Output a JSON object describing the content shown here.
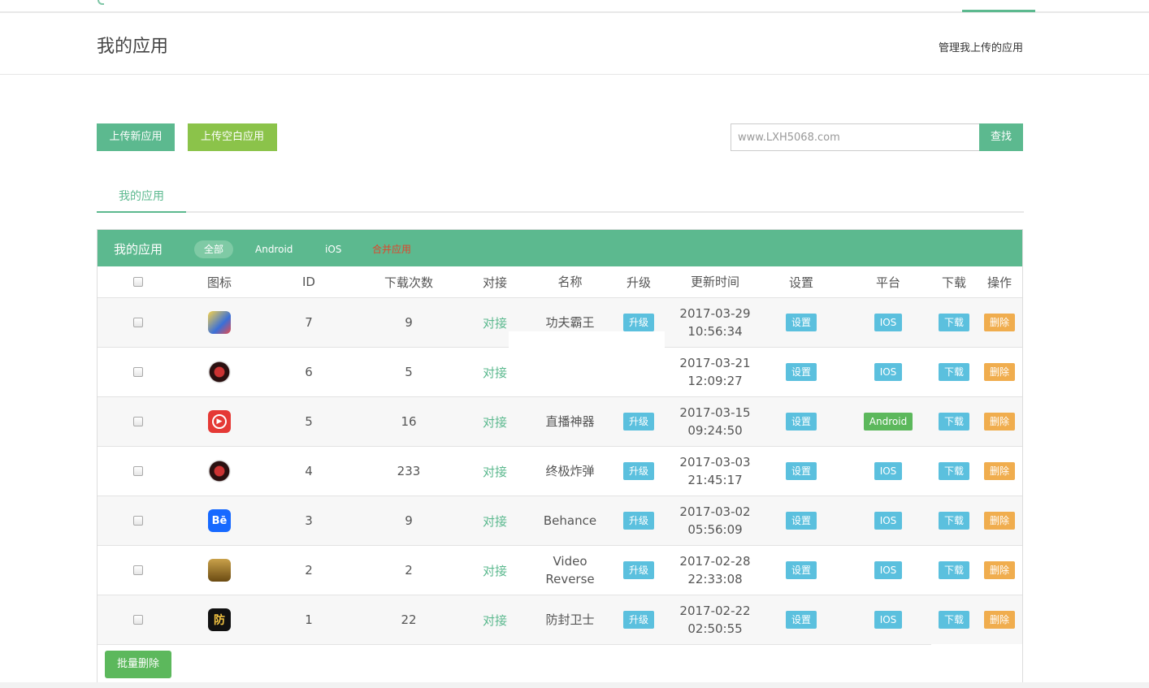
{
  "header": {
    "title": "我的应用",
    "manage_link": "管理我上传的应用"
  },
  "actions": {
    "upload_new": "上传新应用",
    "upload_blank": "上传空白应用",
    "search_value": "www.LXH5068.com",
    "search_button": "查找"
  },
  "tabs": [
    "我的应用"
  ],
  "panel": {
    "title": "我的应用",
    "filters": [
      "全部",
      "Android",
      "iOS",
      "合并应用"
    ],
    "columns": [
      "图标",
      "ID",
      "下载次数",
      "对接",
      "名称",
      "升级",
      "更新时间",
      "设置",
      "平台",
      "下载",
      "操作"
    ],
    "rows": [
      {
        "icon": "game-app-icon",
        "id": "7",
        "downloads": "9",
        "link": "对接",
        "name": "功夫霸王",
        "upgrade": "升级",
        "date": "2017-03-29",
        "time": "10:56:34",
        "settings": "设置",
        "platform": "IOS",
        "download": "下载",
        "delete": "删除"
      },
      {
        "icon": "bomb-app-icon",
        "id": "6",
        "downloads": "5",
        "link": "对接",
        "name": "",
        "upgrade": "",
        "date": "2017-03-21",
        "time": "12:09:27",
        "settings": "设置",
        "platform": "IOS",
        "download": "下载",
        "delete": "删除"
      },
      {
        "icon": "live-app-icon",
        "id": "5",
        "downloads": "16",
        "link": "对接",
        "name": "直播神器",
        "upgrade": "升级",
        "date": "2017-03-15",
        "time": "09:24:50",
        "settings": "设置",
        "platform": "Android",
        "download": "下载",
        "delete": "删除"
      },
      {
        "icon": "bomb-app-icon",
        "id": "4",
        "downloads": "233",
        "link": "对接",
        "name": "终极炸弹",
        "upgrade": "升级",
        "date": "2017-03-03",
        "time": "21:45:17",
        "settings": "设置",
        "platform": "IOS",
        "download": "下载",
        "delete": "删除"
      },
      {
        "icon": "behance-app-icon",
        "id": "3",
        "downloads": "9",
        "link": "对接",
        "name": "Behance",
        "upgrade": "升级",
        "date": "2017-03-02",
        "time": "05:56:09",
        "settings": "设置",
        "platform": "IOS",
        "download": "下载",
        "delete": "删除"
      },
      {
        "icon": "video-app-icon",
        "id": "2",
        "downloads": "2",
        "link": "对接",
        "name": "Video Reverse",
        "upgrade": "升级",
        "date": "2017-02-28",
        "time": "22:33:08",
        "settings": "设置",
        "platform": "IOS",
        "download": "下载",
        "delete": "删除"
      },
      {
        "icon": "guard-app-icon",
        "id": "1",
        "downloads": "22",
        "link": "对接",
        "name": "防封卫士",
        "upgrade": "升级",
        "date": "2017-02-22",
        "time": "02:50:55",
        "settings": "设置",
        "platform": "IOS",
        "download": "下载",
        "delete": "删除"
      }
    ],
    "batch_delete": "批量删除"
  },
  "icon_glyphs": {
    "behance": "Bē",
    "guard": "防",
    "live": "▶"
  },
  "colors": {
    "primary": "#5cb98f",
    "green": "#5cb85c",
    "blue": "#5bc0de",
    "orange": "#f0ad4e",
    "lime": "#8bc34a",
    "merge": "#e0452b"
  }
}
